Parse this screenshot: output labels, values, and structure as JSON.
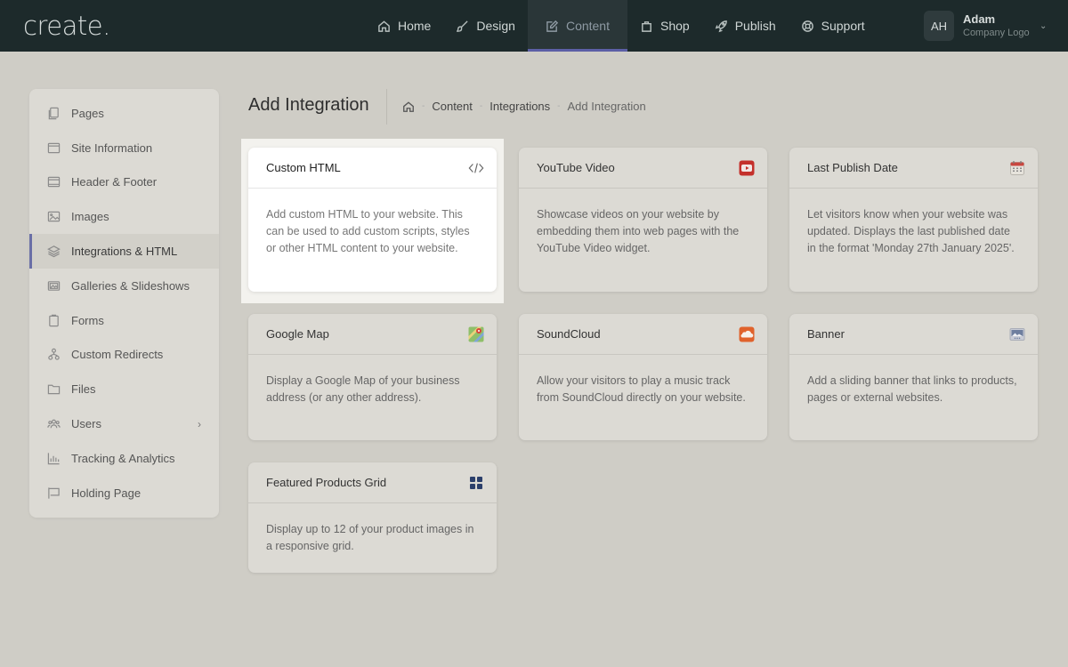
{
  "app": {
    "logo": "create",
    "logo_dot": "."
  },
  "nav": {
    "items": [
      {
        "label": "Home",
        "icon": "home-icon"
      },
      {
        "label": "Design",
        "icon": "brush-icon"
      },
      {
        "label": "Content",
        "icon": "edit-icon",
        "active": true
      },
      {
        "label": "Shop",
        "icon": "shopping-bag-icon"
      },
      {
        "label": "Publish",
        "icon": "rocket-icon"
      },
      {
        "label": "Support",
        "icon": "lifebuoy-icon"
      }
    ]
  },
  "user": {
    "initials": "AH",
    "name": "Adam",
    "subtitle": "Company Logo",
    "caret": "⌄"
  },
  "sidebar": {
    "items": [
      {
        "label": "Pages",
        "icon": "pages-icon"
      },
      {
        "label": "Site Information",
        "icon": "browser-icon"
      },
      {
        "label": "Header & Footer",
        "icon": "layout-icon"
      },
      {
        "label": "Images",
        "icon": "image-icon"
      },
      {
        "label": "Integrations & HTML",
        "icon": "layers-icon",
        "active": true
      },
      {
        "label": "Galleries & Slideshows",
        "icon": "gallery-icon"
      },
      {
        "label": "Forms",
        "icon": "clipboard-icon"
      },
      {
        "label": "Custom Redirects",
        "icon": "redirect-icon"
      },
      {
        "label": "Files",
        "icon": "folder-icon"
      },
      {
        "label": "Users",
        "icon": "users-icon",
        "chevron": "›"
      },
      {
        "label": "Tracking & Analytics",
        "icon": "chart-icon"
      },
      {
        "label": "Holding Page",
        "icon": "holding-page-icon"
      }
    ]
  },
  "header": {
    "title": "Add Integration",
    "breadcrumb": {
      "home_icon": "home-icon",
      "separator": "-",
      "items": [
        "Content",
        "Integrations",
        "Add Integration"
      ]
    }
  },
  "cards": [
    {
      "title": "Custom HTML",
      "icon": "code-icon",
      "description": "Add custom HTML to your website. This can be used to add custom scripts, styles or other HTML content to your website.",
      "highlighted": true
    },
    {
      "title": "YouTube Video",
      "icon": "youtube-icon",
      "description": "Showcase videos on your website by embedding them into web pages with the YouTube Video widget."
    },
    {
      "title": "Last Publish Date",
      "icon": "calendar-icon",
      "description": "Let visitors know when your website was updated. Displays the last published date in the format 'Monday 27th January 2025'."
    },
    {
      "title": "Google Map",
      "icon": "map-icon",
      "description": "Display a Google Map of your business address (or any other address)."
    },
    {
      "title": "SoundCloud",
      "icon": "soundcloud-icon",
      "description": "Allow your visitors to play a music track from SoundCloud directly on your website."
    },
    {
      "title": "Banner",
      "icon": "banner-icon",
      "description": "Add a sliding banner that links to products, pages or external websites."
    },
    {
      "title": "Featured Products Grid",
      "icon": "grid-icon",
      "description": "Display up to 12 of your product images in a responsive grid."
    }
  ],
  "colors": {
    "topbar": "#1d2a2b",
    "accent": "#5c5fa6",
    "youtube": "#c4302b",
    "soundcloud": "#e0622c",
    "grid": "#2b3f6b"
  }
}
